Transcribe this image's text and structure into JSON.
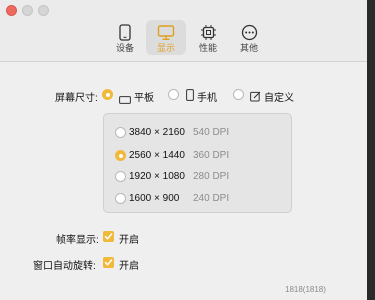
{
  "colors": {
    "accent": "#f1b93a",
    "window_bg": "#f0eff0",
    "toolbar_bg": "#ebebeb"
  },
  "toolbar": {
    "tabs": [
      {
        "label": "设备",
        "icon": "phone-icon",
        "active": false
      },
      {
        "label": "显示",
        "icon": "monitor-icon",
        "active": true
      },
      {
        "label": "性能",
        "icon": "chip-icon",
        "active": false
      },
      {
        "label": "其他",
        "icon": "more-icon",
        "active": false
      }
    ]
  },
  "screen_size": {
    "label": "屏幕尺寸:",
    "options": [
      {
        "label": "平板",
        "icon": "tablet-icon",
        "selected": true
      },
      {
        "label": "手机",
        "icon": "phone-icon",
        "selected": false
      },
      {
        "label": "自定义",
        "icon": "edit-icon",
        "selected": false
      }
    ]
  },
  "resolutions": [
    {
      "size": "3840 × 2160",
      "dpi": "540 DPI",
      "selected": false
    },
    {
      "size": "2560 × 1440",
      "dpi": "360 DPI",
      "selected": true
    },
    {
      "size": "1920 × 1080",
      "dpi": "280 DPI",
      "selected": false
    },
    {
      "size": "1600 × 900",
      "dpi": "240 DPI",
      "selected": false
    }
  ],
  "frame_rate": {
    "label": "帧率显示:",
    "value_label": "开启",
    "checked": true
  },
  "auto_rotate": {
    "label": "窗口自动旋转:",
    "value_label": "开启",
    "checked": true
  },
  "watermark": "1818(1818)"
}
